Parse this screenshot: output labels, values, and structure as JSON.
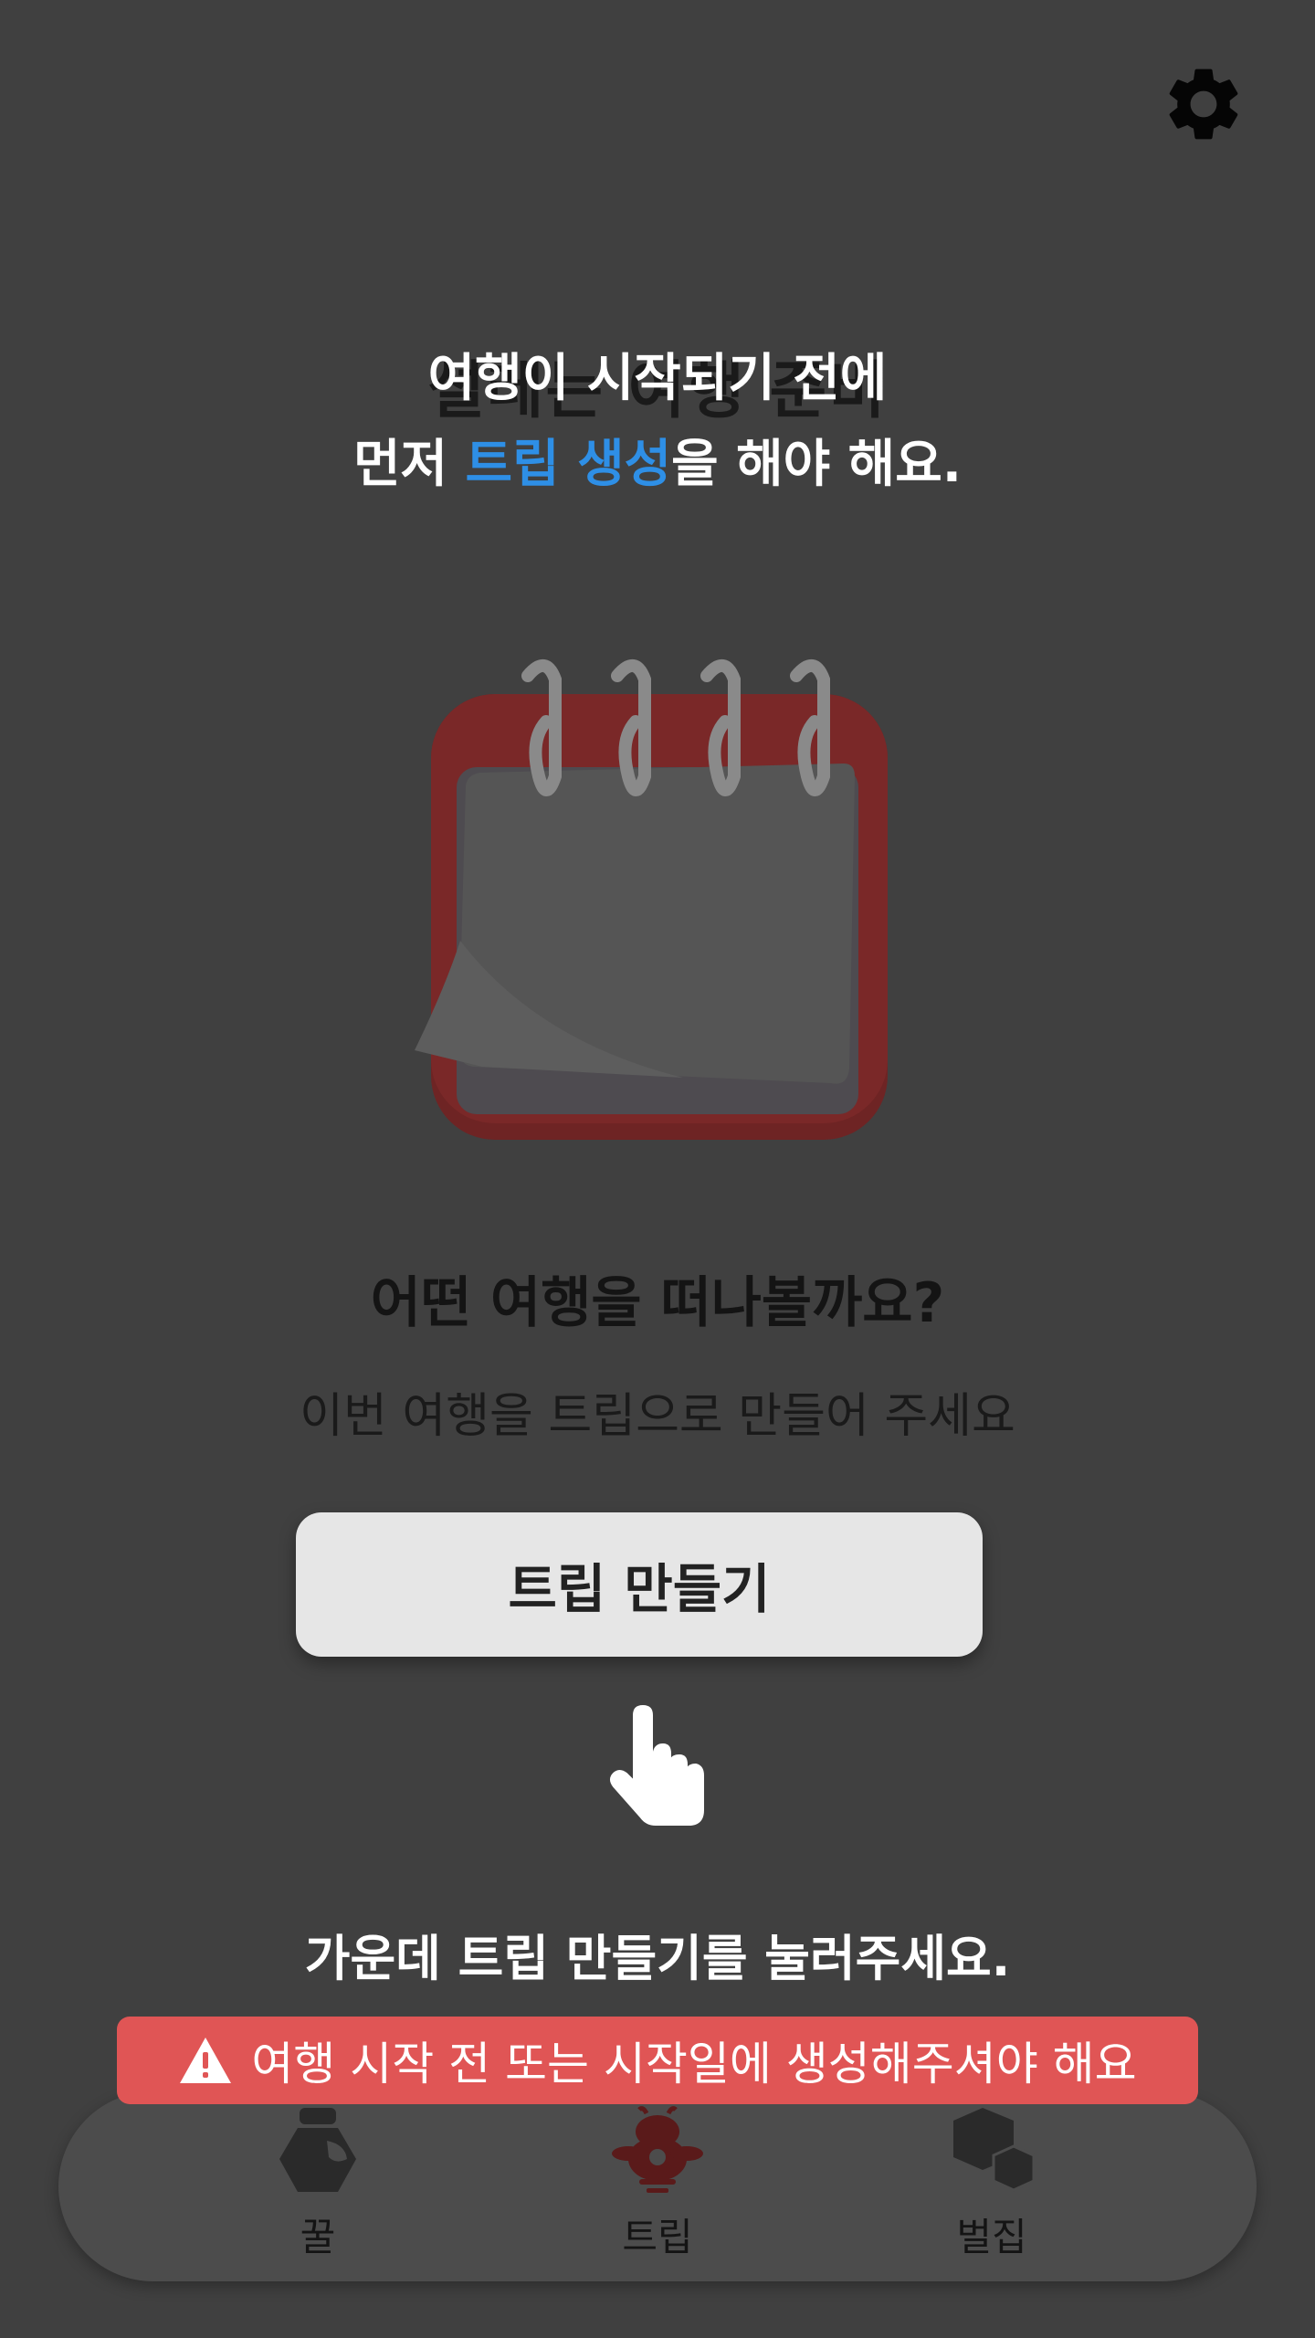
{
  "hidden_title": "설레는 여행 준비",
  "coach_top": {
    "line1": "여행이 시작되기 전에",
    "line2_prefix": "먼저 ",
    "line2_highlight": "트립 생성",
    "line2_suffix": "을 해야 해요."
  },
  "main": {
    "question": "어떤 여행을 떠나볼까요?",
    "subtitle": "이번 여행을 트립으로 만들어 주세요",
    "make_trip_button": "트립 만들기"
  },
  "coach_bottom": "가운데 트립 만들기를 눌러주세요.",
  "warning": "여행 시작 전 또는 시작일에 생성해주셔야 해요",
  "nav": {
    "items": [
      {
        "label": "꿀",
        "icon": "honey-jar-icon"
      },
      {
        "label": "트립",
        "icon": "bee-icon"
      },
      {
        "label": "벌집",
        "icon": "hive-icon"
      }
    ]
  },
  "colors": {
    "overlay": "#404040",
    "highlight": "#2e8fe6",
    "warning": "#e05555",
    "calendar": "#7a2626"
  }
}
